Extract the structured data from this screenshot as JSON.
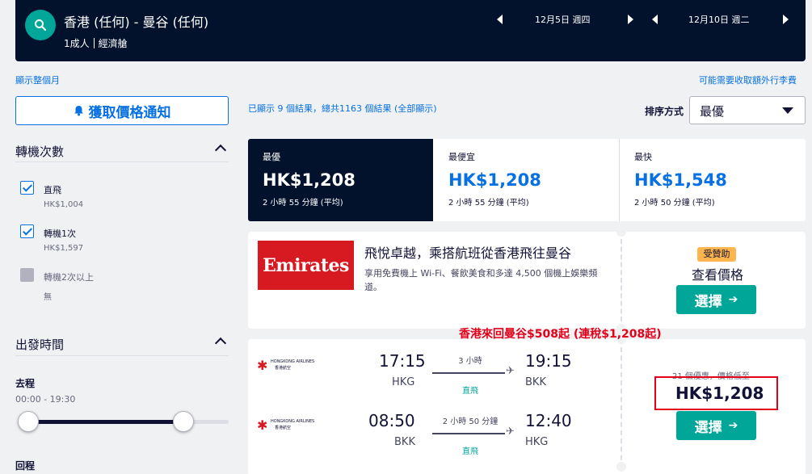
{
  "header": {
    "route": "香港 (任何) - 曼谷 (任何)",
    "passengers": "1成人",
    "cabin": "經濟艙",
    "depart_date": "12月5日 週四",
    "return_date": "12月10日 週二"
  },
  "links": {
    "show_month": "顯示整個月",
    "baggage_fees": "可能需要收取額外行李費"
  },
  "sidebar": {
    "alert_button": "獲取價格通知",
    "stops_title": "轉機次數",
    "stops": [
      {
        "label": "直飛",
        "price": "HK$1,004",
        "checked": true,
        "disabled": false
      },
      {
        "label": "轉機1次",
        "price": "HK$1,597",
        "checked": true,
        "disabled": false
      },
      {
        "label": "轉機2次以上",
        "price": "無",
        "checked": false,
        "disabled": true
      }
    ],
    "departure_title": "出發時間",
    "outbound_label": "去程",
    "outbound_range": "00:00 - 19:30",
    "return_label": "回程"
  },
  "results": {
    "summary": "已顯示 9 個結果，總共1163 個結果 (全部顯示)",
    "sort_label": "排序方式",
    "sort_value": "最優"
  },
  "tabs": [
    {
      "label": "最優",
      "price": "HK$1,208",
      "time": "2 小時 55 分鐘 (平均)"
    },
    {
      "label": "最便宜",
      "price": "HK$1,208",
      "time": "2 小時 55 分鐘 (平均)"
    },
    {
      "label": "最快",
      "price": "HK$1,548",
      "time": "2 小時 50 分鐘 (平均)"
    }
  ],
  "ad": {
    "logo": "Emirates",
    "title": "飛悅卓越，乘搭航班從香港飛往曼谷",
    "description": "享用免費機上 Wi-Fi、餐飲美食和多達 4,500 個機上娛樂頻道。",
    "sponsored": "受贊助",
    "view_price": "查看價格",
    "select": "選擇"
  },
  "promo_text": "香港來回曼谷$508起 (連稅$1,208起)",
  "flight": {
    "airline_name": "HONGKONG AIRLINES",
    "airline_name_cn": "香港航空",
    "outbound": {
      "dep_time": "17:15",
      "dep_apt": "HKG",
      "duration": "3 小時",
      "stops": "直飛",
      "arr_time": "19:15",
      "arr_apt": "BKK"
    },
    "inbound": {
      "dep_time": "08:50",
      "dep_apt": "BKK",
      "duration": "2 小時 50 分鐘",
      "stops": "直飛",
      "arr_time": "12:40",
      "arr_apt": "HKG"
    },
    "deals": "21 個優惠，價格低至",
    "price": "HK$1,208",
    "select": "選擇"
  },
  "colors": {
    "header_bg": "#02122c",
    "accent_teal": "#00a698",
    "link_blue": "#0770e3",
    "promo_red": "#e2001a",
    "emirates_red": "#d71921"
  }
}
